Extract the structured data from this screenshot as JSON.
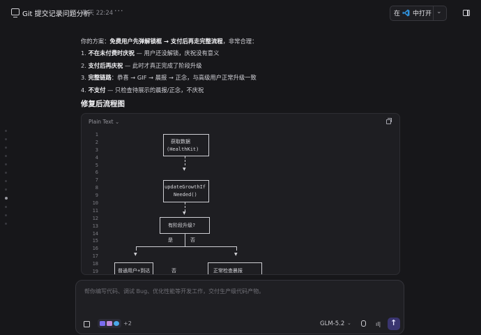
{
  "topbar": {
    "title": "Git 提交记录问题分析",
    "time": "昨天 22:24",
    "more": "···",
    "open_prefix": "在",
    "open_label": "中打开",
    "open_chevron": "⌄",
    "panel_toggle_icon": "sidebar-icon"
  },
  "message": {
    "intro_plain": "你的方案：",
    "intro_bold": "免费用户先弹解锁框 → 支付后再走完整流程",
    "intro_tail": "，非常合理：",
    "items": [
      {
        "num": "1.",
        "bold": "不在未付费时庆祝",
        "text": " — 用户还没解锁，庆祝没有意义"
      },
      {
        "num": "2.",
        "bold": "支付后再庆祝",
        "text": " — 此时才真正完成了阶段升级"
      },
      {
        "num": "3.",
        "bold": "完整链路",
        "text": "：恭喜 → GIF → 晨报 → 正念，与高级用户正常升级一致"
      },
      {
        "num": "4.",
        "bold": "不支付",
        "text": " — 只检查待展示的晨报/正念，不庆祝"
      }
    ],
    "section_title": "修复后流程图"
  },
  "code_block": {
    "language": "Plain Text",
    "language_chevron": "⌄",
    "line_numbers": [
      "1",
      "2",
      "3",
      "4",
      "5",
      "6",
      "7",
      "8",
      "9",
      "10",
      "11",
      "12",
      "13",
      "14",
      "15",
      "16",
      "17",
      "18",
      "19"
    ],
    "node1_line1": "获取数据",
    "node1_line2": "(HealthKit)",
    "node2_line1": "updateGrowthIf",
    "node2_line2": "Needed()",
    "node3": "有阶段升级?",
    "yes": "是",
    "no": "否",
    "arrow": "▼",
    "left_node": "普通用户+到达",
    "mid_no": "否",
    "right_node": "正常检查晨报"
  },
  "input": {
    "placeholder": "帮你编写代码、调试 Bug、优化性能等开发工作，交付生产级代码产物。",
    "extra_count": "+2",
    "model": "GLM-5.2",
    "model_chevron": "⌄",
    "wave": "ıl|"
  }
}
